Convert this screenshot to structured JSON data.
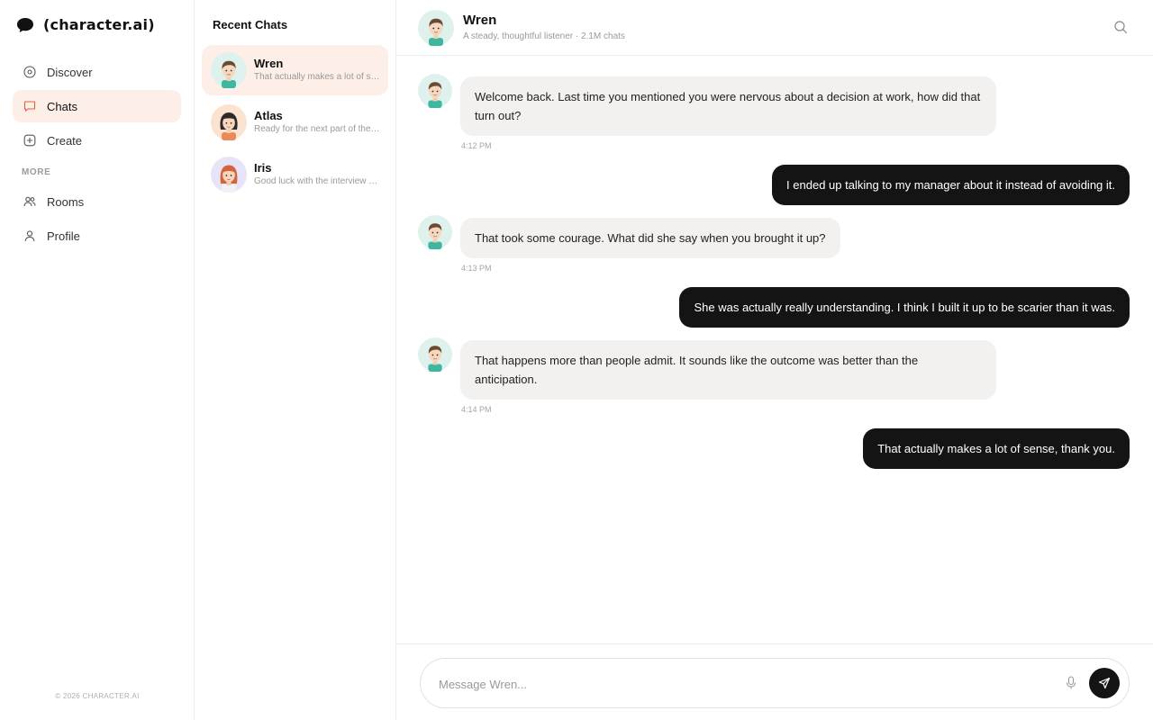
{
  "brand": {
    "name": "(character.ai)",
    "icon": "speech-bubble-icon"
  },
  "nav": {
    "items": [
      {
        "label": "Discover",
        "icon": "compass-icon"
      },
      {
        "label": "Chats",
        "icon": "chat-icon",
        "active": true
      },
      {
        "label": "Create",
        "icon": "plus-square-icon"
      }
    ],
    "section_label": "MORE",
    "more_items": [
      {
        "label": "Rooms",
        "icon": "people-icon"
      },
      {
        "label": "Profile",
        "icon": "user-icon"
      }
    ],
    "footer": "© 2026 CHARACTER.AI"
  },
  "recent": {
    "title": "Recent Chats",
    "items": [
      {
        "name": "Wren",
        "preview": "That actually makes a lot of sense, thank you.",
        "active": true
      },
      {
        "name": "Atlas",
        "preview": "Ready for the next part of the story?"
      },
      {
        "name": "Iris",
        "preview": "Good luck with the interview tomorrow!"
      }
    ]
  },
  "chat": {
    "name": "Wren",
    "subtitle": "A steady, thoughtful listener · 2.1M chats",
    "messages": [
      {
        "from": "bot",
        "text": "Welcome back. Last time you mentioned you were nervous about a decision at work, how did that turn out?",
        "time": "4:12 PM"
      },
      {
        "from": "user",
        "text": "I ended up talking to my manager about it instead of avoiding it."
      },
      {
        "from": "bot",
        "text": "That took some courage. What did she say when you brought it up?",
        "time": "4:13 PM"
      },
      {
        "from": "user",
        "text": "She was actually really understanding. I think I built it up to be scarier than it was."
      },
      {
        "from": "bot",
        "text": "That happens more than people admit. It sounds like the outcome was better than the anticipation.",
        "time": "4:14 PM"
      },
      {
        "from": "user",
        "text": "That actually makes a lot of sense, thank you."
      }
    ],
    "composer_placeholder": "Message Wren..."
  },
  "colors": {
    "active_bg": "#fdeee8",
    "user_bubble": "#141414",
    "bot_bubble": "#f2f1f0",
    "accent": "#e0643a"
  }
}
